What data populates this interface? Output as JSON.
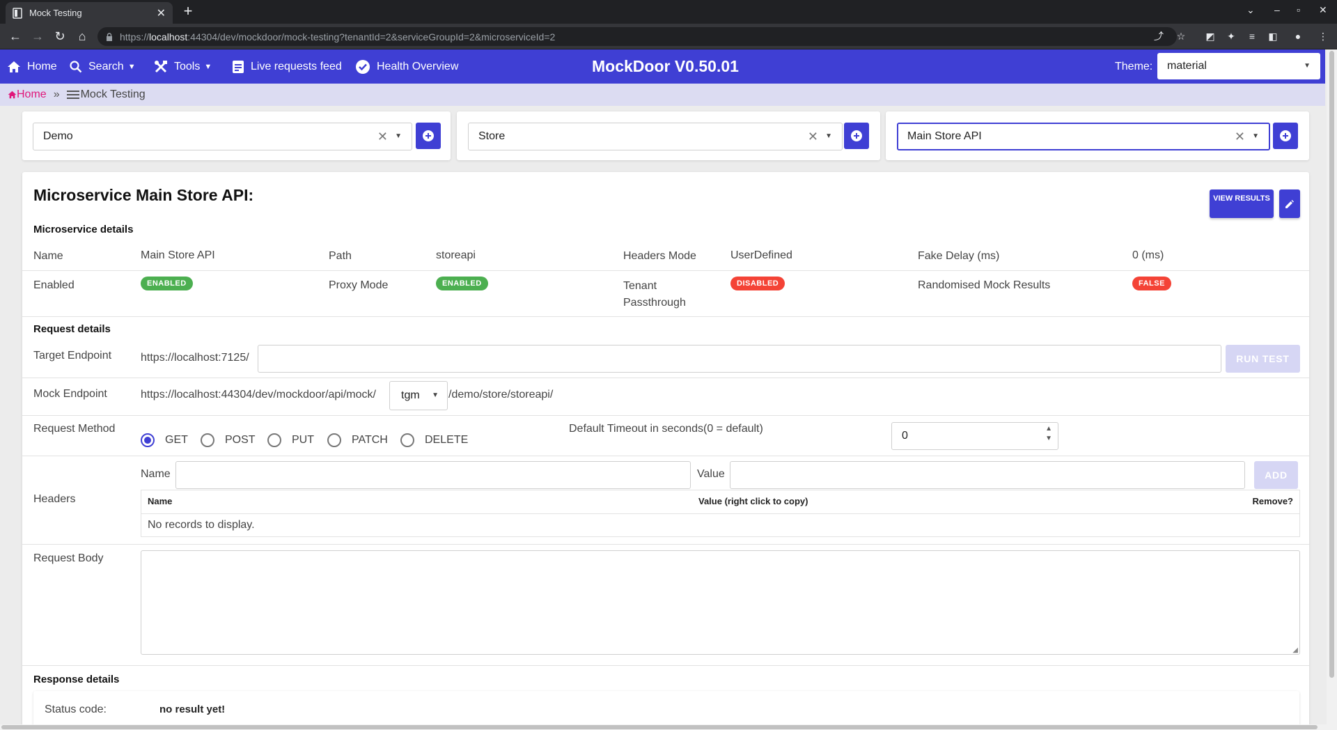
{
  "browser": {
    "tab_title": "Mock Testing",
    "url_prefix": "https://",
    "url_host": "localhost",
    "url_rest": ":44304/dev/mockdoor/mock-testing?tenantId=2&serviceGroupId=2&microserviceId=2"
  },
  "nav": {
    "home": "Home",
    "search": "Search",
    "tools": "Tools",
    "live_feed": "Live requests feed",
    "health": "Health Overview",
    "app_title": "MockDoor V0.50.01",
    "theme_label": "Theme:",
    "theme_value": "material",
    "accent": "#3f3fd4"
  },
  "breadcrumb": {
    "home": "Home",
    "separator": "»",
    "current": "Mock Testing"
  },
  "selectors": {
    "tenant": "Demo",
    "service_group": "Store",
    "microservice": "Main Store API"
  },
  "main": {
    "title": "Microservice Main Store API:",
    "view_results": "VIEW RESULTS",
    "microservice_details": {
      "heading": "Microservice details",
      "name_label": "Name",
      "name_value": "Main Store API",
      "path_label": "Path",
      "path_value": "storeapi",
      "headers_mode_label": "Headers Mode",
      "headers_mode_value": "UserDefined",
      "fake_delay_label": "Fake Delay (ms)",
      "fake_delay_value": "0 (ms)",
      "enabled_label": "Enabled",
      "enabled_badge": "ENABLED",
      "proxy_mode_label": "Proxy Mode",
      "proxy_mode_badge": "ENABLED",
      "tenant_pass_label_1": "Tenant",
      "tenant_pass_label_2": "Passthrough",
      "tenant_pass_badge": "DISABLED",
      "randomised_label": "Randomised Mock Results",
      "randomised_badge": "FALSE"
    },
    "request_details": {
      "heading": "Request details",
      "target_label": "Target Endpoint",
      "target_prefix": "https://localhost:7125/",
      "target_value": "",
      "run_test": "RUN TEST",
      "mock_label": "Mock Endpoint",
      "mock_prefix": "https://localhost:44304/dev/mockdoor/api/mock/",
      "mock_select": "tgm",
      "mock_suffix": "/demo/store/storeapi/",
      "method_label": "Request Method",
      "methods": [
        "GET",
        "POST",
        "PUT",
        "PATCH",
        "DELETE"
      ],
      "selected_method": "GET",
      "timeout_label": "Default Timeout in seconds(0 = default)",
      "timeout_value": "0",
      "headers_label": "Headers",
      "header_name_label": "Name",
      "header_value_label": "Value",
      "add_button": "ADD",
      "grid_col_name": "Name",
      "grid_col_value": "Value (right click to copy)",
      "grid_col_remove": "Remove?",
      "grid_empty": "No records to display.",
      "body_label": "Request Body",
      "body_value": ""
    },
    "response_details": {
      "heading": "Response details",
      "status_label": "Status code:",
      "status_value": "no result yet!"
    }
  }
}
